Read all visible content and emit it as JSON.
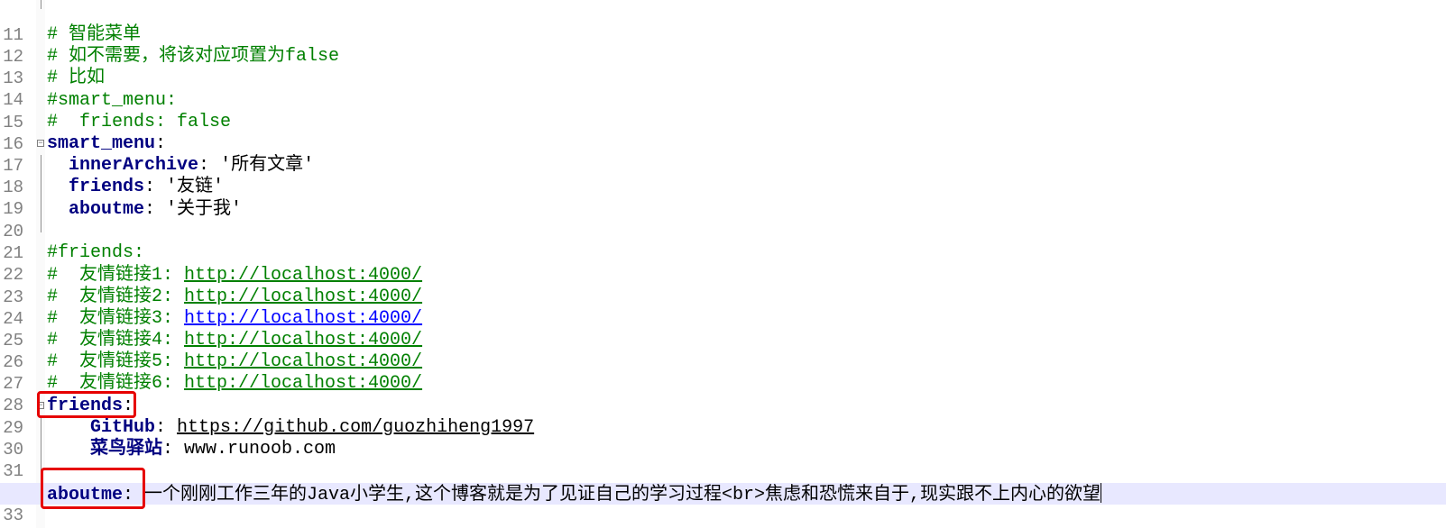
{
  "editor": {
    "lines": [
      {
        "num": "11",
        "code": ""
      },
      {
        "num": "12",
        "code": "# 智能菜单"
      },
      {
        "num": "13",
        "code": "# 如不需要，将该对应项置为false"
      },
      {
        "num": "14",
        "code": "# 比如"
      },
      {
        "num": "15",
        "code": "#smart_menu:"
      },
      {
        "num": "16",
        "code": "#  friends: false"
      },
      {
        "num": "17",
        "key": "smart_menu",
        "sep": ":"
      },
      {
        "num": "18",
        "indent": "  ",
        "key": "innerArchive",
        "sep": ": ",
        "value": "'所有文章'"
      },
      {
        "num": "19",
        "indent": "  ",
        "key": "friends",
        "sep": ": ",
        "value": "'友链'"
      },
      {
        "num": "20",
        "indent": "  ",
        "key": "aboutme",
        "sep": ": ",
        "value": "'关于我'"
      },
      {
        "num": "21",
        "code": ""
      },
      {
        "num": "22",
        "code": "#friends:"
      },
      {
        "num": "23",
        "comment": "#  友情链接1: ",
        "link": "http://localhost:4000/"
      },
      {
        "num": "24",
        "comment": "#  友情链接2: ",
        "link": "http://localhost:4000/"
      },
      {
        "num": "25",
        "comment": "#  友情链接3: ",
        "link": "http://localhost:4000/"
      },
      {
        "num": "26",
        "comment": "#  友情链接4: ",
        "link": "http://localhost:4000/"
      },
      {
        "num": "27",
        "comment": "#  友情链接5: ",
        "link": "http://localhost:4000/"
      },
      {
        "num": "28",
        "comment": "#  友情链接6: ",
        "link": "http://localhost:4000/"
      },
      {
        "num": "29",
        "key": "friends",
        "sep": ":"
      },
      {
        "num": "30",
        "indent": "    ",
        "key": "GitHub",
        "sep": ": ",
        "url": "https://github.com/guozhiheng1997"
      },
      {
        "num": "31",
        "indent": "    ",
        "key": "菜鸟驿站",
        "sep": ": ",
        "value": "www.runoob.com"
      },
      {
        "num": "32",
        "code": ""
      },
      {
        "num": "33",
        "key": "aboutme",
        "sep": ": ",
        "value": "一个刚刚工作三年的Java小学生,这个博客就是为了见证自己的学习过程<br>焦虑和恐慌来自于,现实跟不上内心的欲望"
      }
    ]
  },
  "colors": {
    "comment": "#008000",
    "key": "#000080",
    "link_visited": "#0000ff",
    "highlight_box": "#e60000",
    "current_line": "#e8e8ff"
  }
}
